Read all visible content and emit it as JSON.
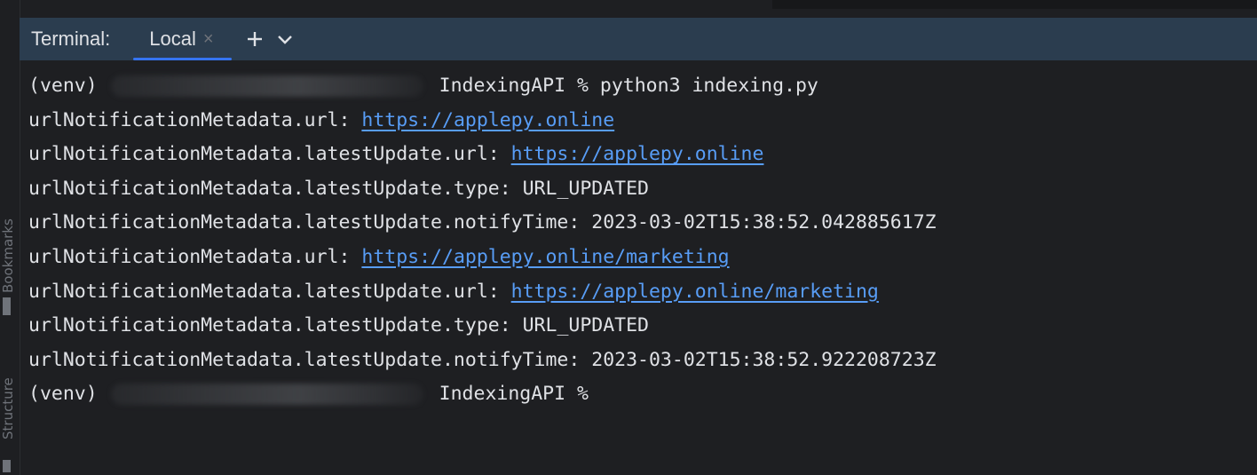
{
  "panel": {
    "tool_label": "Terminal:",
    "tab_label": "Local",
    "close_glyph": "×",
    "plus_glyph": "+",
    "chevron_glyph": "⌄"
  },
  "side_tools": {
    "bookmarks": "Bookmarks",
    "structure": "Structure"
  },
  "terminal": {
    "prompt_env": "(venv)",
    "prompt_dir": "IndexingAPI %",
    "command": "python3 indexing.py",
    "lines": [
      {
        "key": "urlNotificationMetadata.url: ",
        "value": "https://applepy.online",
        "link": true
      },
      {
        "key": "urlNotificationMetadata.latestUpdate.url: ",
        "value": "https://applepy.online",
        "link": true
      },
      {
        "key": "urlNotificationMetadata.latestUpdate.type: ",
        "value": "URL_UPDATED",
        "link": false
      },
      {
        "key": "urlNotificationMetadata.latestUpdate.notifyTime: ",
        "value": "2023-03-02T15:38:52.042885617Z",
        "link": false
      },
      {
        "key": "urlNotificationMetadata.url: ",
        "value": "https://applepy.online/marketing",
        "link": true
      },
      {
        "key": "urlNotificationMetadata.latestUpdate.url: ",
        "value": "https://applepy.online/marketing",
        "link": true
      },
      {
        "key": "urlNotificationMetadata.latestUpdate.type: ",
        "value": "URL_UPDATED",
        "link": false
      },
      {
        "key": "urlNotificationMetadata.latestUpdate.notifyTime: ",
        "value": "2023-03-02T15:38:52.922208723Z",
        "link": false
      }
    ]
  },
  "colors": {
    "background": "#1e1f22",
    "tab_bar": "#2b3d4f",
    "text": "#dfe1e5",
    "link": "#589df6",
    "accent": "#3574f0"
  }
}
